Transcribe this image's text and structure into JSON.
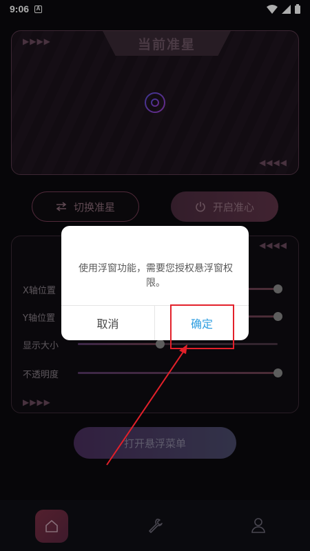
{
  "status_bar": {
    "time": "9:06",
    "notif_letter": "A"
  },
  "top_card": {
    "title": "当前准星"
  },
  "buttons": {
    "switch_crosshair": "切换准星",
    "open_crosshair": "开启准心",
    "open_float_menu": "打开悬浮菜单"
  },
  "settings": [
    {
      "label": "X轴位置",
      "value": 1.0
    },
    {
      "label": "Y轴位置",
      "value": 1.0
    },
    {
      "label": "显示大小",
      "value": 0.41
    },
    {
      "label": "不透明度",
      "value": 1.0
    }
  ],
  "dialog": {
    "message": "使用浮窗功能，需要您授权悬浮窗权限。",
    "cancel": "取消",
    "confirm": "确定"
  },
  "colors": {
    "accent": "#7a2f44",
    "confirm": "#2f9ee0",
    "highlight": "#e3202a"
  }
}
